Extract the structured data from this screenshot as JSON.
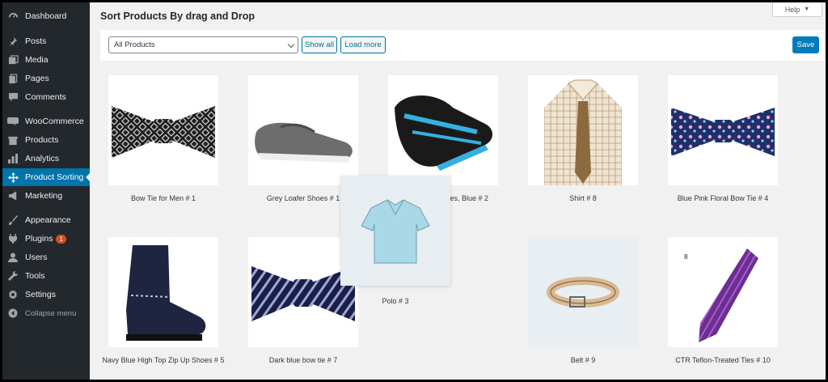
{
  "sidebar": {
    "items": [
      {
        "label": "Dashboard",
        "icon": "dashboard-icon"
      },
      {
        "label": "Posts",
        "icon": "pin-icon"
      },
      {
        "label": "Media",
        "icon": "media-icon"
      },
      {
        "label": "Pages",
        "icon": "pages-icon"
      },
      {
        "label": "Comments",
        "icon": "comment-icon"
      },
      {
        "label": "WooCommerce",
        "icon": "woocommerce-icon"
      },
      {
        "label": "Products",
        "icon": "archive-icon"
      },
      {
        "label": "Analytics",
        "icon": "bar-chart-icon"
      },
      {
        "label": "Product Sorting",
        "icon": "move-icon",
        "active": true
      },
      {
        "label": "Marketing",
        "icon": "megaphone-icon"
      },
      {
        "label": "Appearance",
        "icon": "paintbrush-icon"
      },
      {
        "label": "Plugins",
        "icon": "plugin-icon",
        "badge": "1"
      },
      {
        "label": "Users",
        "icon": "user-icon"
      },
      {
        "label": "Tools",
        "icon": "wrench-icon"
      },
      {
        "label": "Settings",
        "icon": "settings-icon"
      }
    ],
    "collapse_label": "Collapse menu"
  },
  "header": {
    "title": "Sort Products By drag and Drop",
    "help_label": "Help"
  },
  "toolbar": {
    "select_value": "All Products",
    "show_all_label": "Show all",
    "load_more_label": "Load more",
    "save_label": "Save"
  },
  "products": [
    {
      "label": "Bow Tie for Men # 1"
    },
    {
      "label": "Grey Loafer Shoes # 1"
    },
    {
      "label": "orienteering shoes, Blue # 2"
    },
    {
      "label": "Shirt # 8"
    },
    {
      "label": "Blue Pink Floral Bow Tie # 4"
    },
    {
      "label": "Navy Blue High Top Zip Up Shoes # 5"
    },
    {
      "label": "Dark blue bow tie # 7"
    },
    {
      "label": "Belt # 9"
    },
    {
      "label": "CTR Teflon-Treated Ties # 10",
      "corner_text": "8"
    }
  ],
  "dragging": {
    "label": "Polo # 3"
  },
  "colors": {
    "sidebar_bg": "#23282d",
    "accent": "#0073aa",
    "primary_button": "#007cba",
    "page_bg": "#f1f1f1"
  }
}
